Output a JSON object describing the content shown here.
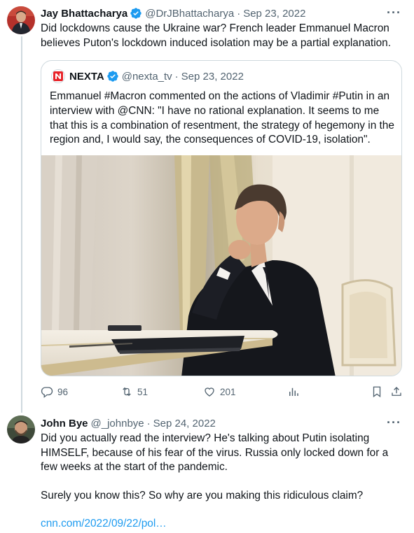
{
  "tweet1": {
    "name": "Jay Bhattacharya",
    "handle": "@DrJBhattacharya",
    "date": "Sep 23, 2022",
    "text": "Did lockdowns cause the Ukraine war? French leader Emmanuel Macron believes Puton's lockdown induced isolation may be a partial explanation.",
    "quote": {
      "name": "NEXTA",
      "handle": "@nexta_tv",
      "date": "Sep 23, 2022",
      "text": "Emmanuel #Macron commented on the actions of Vladimir #Putin in an interview with @CNN: \"I have no rational explanation. It seems to me that this is a combination of resentment, the strategy of hegemony in the region and, I would say, the consequences of COVID-19, isolation\"."
    },
    "stats": {
      "replies": "96",
      "retweets": "51",
      "likes": "201"
    }
  },
  "tweet2": {
    "name": "John Bye",
    "handle": "@_johnbye",
    "date": "Sep 24, 2022",
    "text_p1": "Did you actually read the interview? He's talking about Putin isolating HIMSELF, because of his fear of the virus. Russia only locked down for a few weeks at the start of the pandemic.",
    "text_p2": "Surely you know this? So why are you making this ridiculous claim?",
    "link": "cnn.com/2022/09/22/pol…"
  },
  "icons": [
    "more-icon",
    "verified-icon",
    "reply-icon",
    "retweet-icon",
    "like-icon",
    "analytics-icon",
    "bookmark-icon",
    "share-icon"
  ],
  "colors": {
    "text": "#0f1419",
    "secondary": "#536471",
    "accent": "#1d9bf0",
    "border": "#cfd9de"
  }
}
